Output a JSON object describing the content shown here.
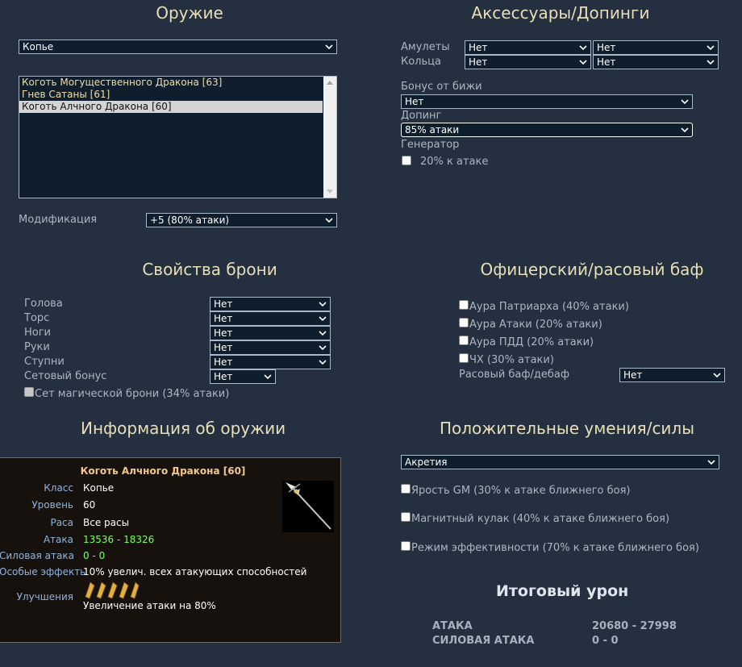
{
  "weapon": {
    "title": "Оружие",
    "type_select": "Копье",
    "list": [
      {
        "name": "Коготь Могущественного Дракона [63]",
        "state": "gold"
      },
      {
        "name": "Гнев Сатаны [61]",
        "state": "gold"
      },
      {
        "name": "Коготь Алчного Дракона [60]",
        "state": "selected"
      }
    ],
    "mod_label": "Модификация",
    "mod_select": "+5 (80% атаки)"
  },
  "accessories": {
    "title": "Аксессуары/Допинги",
    "amulets_label": "Амулеты",
    "amulet1": "Нет",
    "amulet2": "Нет",
    "rings_label": "Кольца",
    "ring1": "Нет",
    "ring2": "Нет",
    "jewel_bonus_label": "Бонус от бижи",
    "jewel_bonus": "Нет",
    "doping_label": "Допинг",
    "doping": "85% атаки",
    "generator_label": "Генератор",
    "generator_option": "20% к атаке"
  },
  "armor": {
    "title": "Свойства брони",
    "rows": [
      {
        "label": "Голова",
        "value": "Нет"
      },
      {
        "label": "Торс",
        "value": "Нет"
      },
      {
        "label": "Ноги",
        "value": "Нет"
      },
      {
        "label": "Руки",
        "value": "Нет"
      },
      {
        "label": "Ступни",
        "value": "Нет"
      }
    ],
    "set_bonus_label": "Сетовый бонус",
    "set_bonus": "Нет",
    "magic_set": "Сет магической брони (34% атаки)"
  },
  "officer": {
    "title": "Офицерский/расовый баф",
    "auras": [
      "Аура Патриарха (40% атаки)",
      "Аура Атаки (20% атаки)",
      "Аура ПДД (20% атаки)",
      "ЧХ (30% атаки)"
    ],
    "race_label": "Расовый баф/дебаф",
    "race_value": "Нет"
  },
  "info": {
    "title": "Информация об оружии",
    "item_name": "Коготь Алчного Дракона [60]",
    "rows": [
      {
        "k": "Класс",
        "v": "Копье"
      },
      {
        "k": "Уровень",
        "v": "60"
      },
      {
        "k": "Раса",
        "v": "Все расы"
      },
      {
        "k": "Атака",
        "v": "13536 - 18326"
      },
      {
        "k": "Силовая атака",
        "v": "0 - 0"
      },
      {
        "k": "Особые эффекты",
        "v": "10% увелич. всех атакующих способностей"
      },
      {
        "k": "Улучшения",
        "v": ""
      }
    ],
    "upgrade_text": "Увеличение атаки на 80%"
  },
  "skills": {
    "title": "Положительные умения/силы",
    "select": "Акретия",
    "options": [
      "Ярость GM (30% к атаке ближнего боя)",
      "Магнитный кулак (40% к атаке ближнего боя)",
      "Режим эффективности (70% к атаке ближнего боя)"
    ]
  },
  "total": {
    "title": "Итоговый урон",
    "attack_label": "АТАКА",
    "attack_value": "20680 - 27998",
    "force_label": "СИЛОВАЯ АТАКА",
    "force_value": "0 - 0"
  },
  "colors": {
    "background": "#243040",
    "heading": "#e8dfb8",
    "field": "#0f1e2c",
    "card": "#17110e",
    "card_key": "#8fb4dc",
    "card_green": "#7cff5a",
    "card_title": "#f2c88a"
  }
}
